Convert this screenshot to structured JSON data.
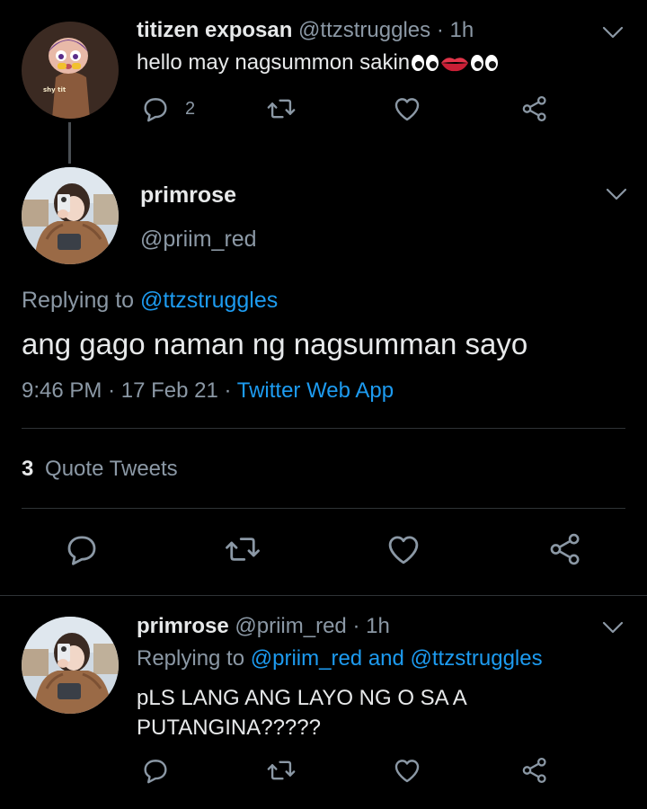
{
  "thread_tweet": {
    "display_name": "titizen exposan",
    "handle": "@ttzstruggles",
    "separator": "·",
    "time": "1h",
    "text": "hello may nagsummon sakin",
    "emoji_sequence": [
      "eyes-emoji",
      "lips-emoji",
      "eyes-emoji"
    ],
    "avatar_caption": "shy tit",
    "reply_count": "2"
  },
  "main_tweet": {
    "display_name": "primrose",
    "handle": "@priim_red",
    "replying_prefix": "Replying to",
    "replying_to": "@ttzstruggles",
    "text": "ang gago naman ng nagsumman sayo",
    "time": "9:46 PM",
    "separator": "·",
    "date": "17 Feb 21",
    "client": "Twitter Web App",
    "quote_count": "3",
    "quote_label": "Quote Tweets"
  },
  "reply_tweet": {
    "display_name": "primrose",
    "handle": "@priim_red",
    "separator": "·",
    "time": "1h",
    "replying_prefix": "Replying to",
    "replying_to": "@priim_red and @ttzstruggles",
    "text_line1": "pLS LANG ANG LAYO NG O SA A",
    "text_line2": "PUTANGINA?????"
  },
  "colors": {
    "background": "#000000",
    "primary_text": "#e7e9ea",
    "muted_text": "#8b98a5",
    "link": "#1d9bf0",
    "divider": "#2f3336"
  },
  "icons": [
    "reply-icon",
    "retweet-icon",
    "like-icon",
    "share-icon",
    "chevron-down-icon"
  ]
}
